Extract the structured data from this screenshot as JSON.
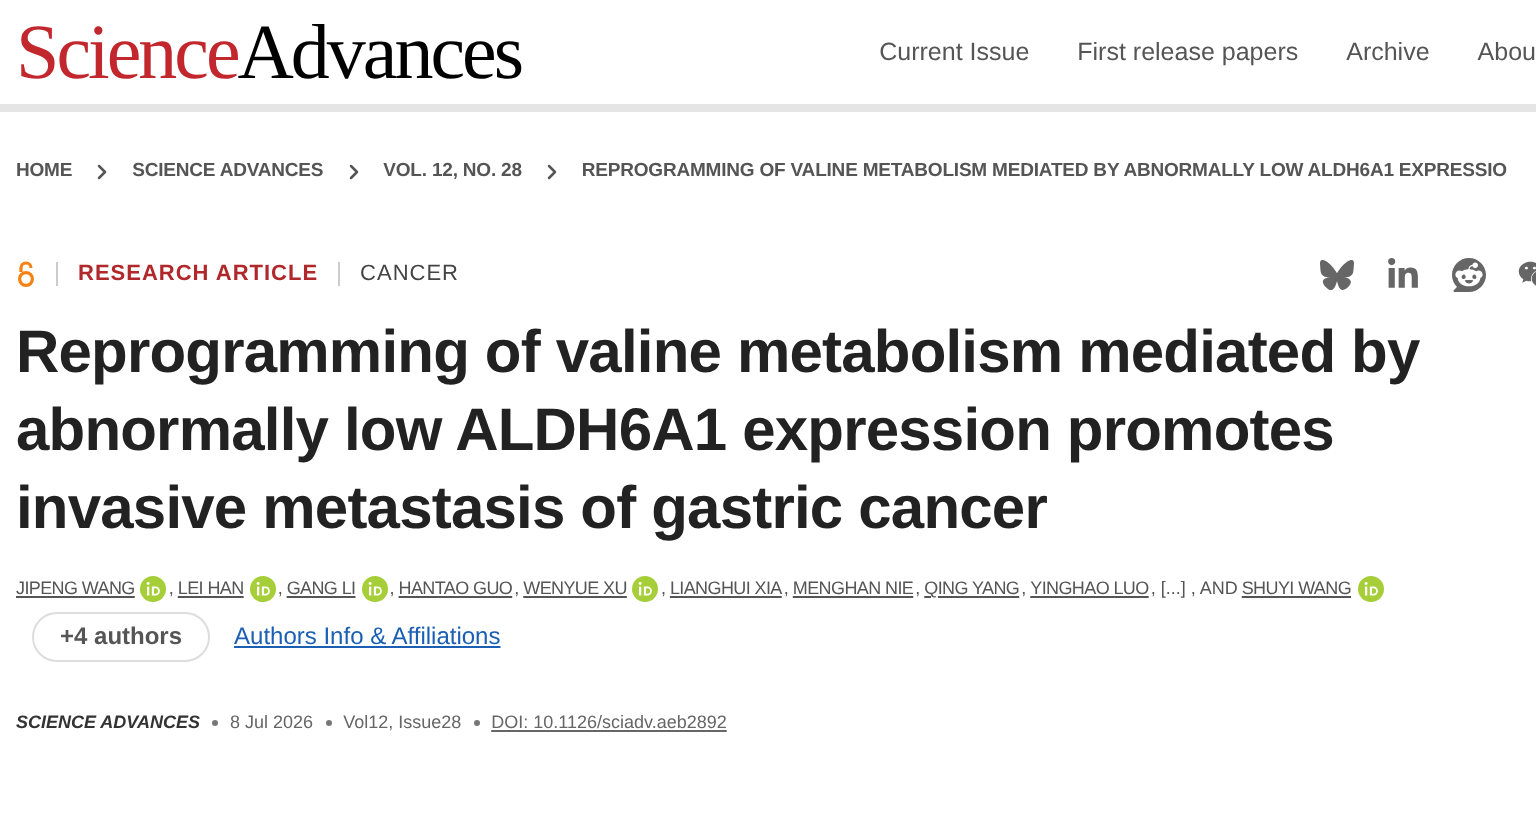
{
  "logo": {
    "part_1": "Science",
    "part_2": "Advances"
  },
  "nav": [
    "Current Issue",
    "First release papers",
    "Archive",
    "Abou"
  ],
  "breadcrumb": [
    "HOME",
    "SCIENCE ADVANCES",
    "VOL. 12, NO. 28",
    "REPROGRAMMING OF VALINE METABOLISM MEDIATED BY ABNORMALLY LOW ALDH6A1 EXPRESSIO"
  ],
  "article_type": "RESEARCH ARTICLE",
  "subject": "CANCER",
  "open_access": true,
  "title": "Reprogramming of valine metabolism mediated by abnormally low ALDH6A1 expression promotes invasive metastasis of gastric cancer",
  "authors": [
    {
      "name": "JIPENG WANG",
      "orcid": true,
      "after": ","
    },
    {
      "name": "LEI HAN",
      "orcid": true,
      "after": ","
    },
    {
      "name": "GANG LI",
      "orcid": true,
      "after": ","
    },
    {
      "name": "HANTAO GUO",
      "orcid": false,
      "after": ","
    },
    {
      "name": "WENYUE XU",
      "orcid": true,
      "after": ","
    },
    {
      "name": "LIANGHUI XIA",
      "orcid": false,
      "after": ","
    },
    {
      "name": "MENGHAN NIE",
      "orcid": false,
      "after": ","
    },
    {
      "name": "QING YANG",
      "orcid": false,
      "after": ","
    },
    {
      "name": "YINGHAO LUO",
      "orcid": false,
      "after": ", [...] , AND"
    },
    {
      "name": "SHUYI WANG",
      "orcid": true
    }
  ],
  "more_authors": "+4 authors",
  "affiliations_link": "Authors Info & Affiliations",
  "meta": {
    "journal": "SCIENCE ADVANCES",
    "date": "8 Jul 2026",
    "issue": "Vol12, Issue28",
    "doi": "DOI: 10.1126/sciadv.aeb2892"
  }
}
